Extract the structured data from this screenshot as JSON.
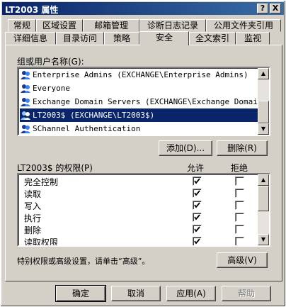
{
  "window": {
    "title": "LT2003 属性",
    "help_btn": "?",
    "close_btn": "X"
  },
  "tabs_row1": [
    "常规",
    "区域设置",
    "邮箱管理",
    "诊断日志记录",
    "公用文件夹引用"
  ],
  "tabs_row2": [
    "详细信息",
    "目录访问",
    "策略",
    "安全",
    "全文索引",
    "监视"
  ],
  "groups": {
    "label": "组或用户名称(G):",
    "items": [
      "Enterprise Admins (EXCHANGE\\Enterprise Admins)",
      "Everyone",
      "Exchange Domain Servers (EXCHANGE\\Exchange Domai...",
      "LT2003$ (EXCHANGE\\LT2003$)",
      "SChannel Authentication"
    ],
    "selected_index": 3
  },
  "buttons": {
    "add": "添加(D)...",
    "remove": "删除(R)",
    "advanced": "高级(V)",
    "ok": "确定",
    "cancel": "取消",
    "apply": "应用(A)",
    "help": "帮助"
  },
  "permissions": {
    "label": "LT2003$ 的权限(P)",
    "col_allow": "允许",
    "col_deny": "拒绝",
    "rows": [
      {
        "name": "完全控制",
        "allow": true,
        "deny": false
      },
      {
        "name": "读取",
        "allow": true,
        "deny": false
      },
      {
        "name": "写入",
        "allow": true,
        "deny": false
      },
      {
        "name": "执行",
        "allow": true,
        "deny": false
      },
      {
        "name": "删除",
        "allow": true,
        "deny": false
      },
      {
        "name": "读取权限",
        "allow": true,
        "deny": false
      }
    ]
  },
  "advanced_hint": "特别权限或高级设置，请单击“高级”。"
}
